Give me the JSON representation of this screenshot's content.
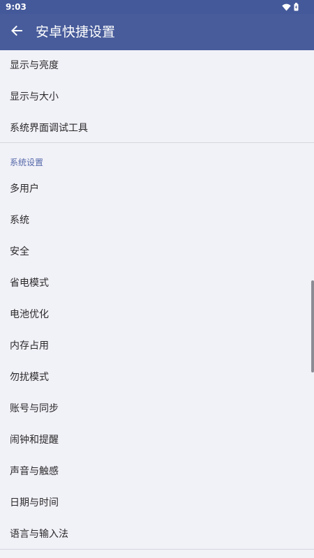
{
  "status_bar": {
    "time": "9:03"
  },
  "app_bar": {
    "title": "安卓快捷设置"
  },
  "group1": {
    "items": [
      {
        "label": "显示与亮度"
      },
      {
        "label": "显示与大小"
      },
      {
        "label": "系统界面调试工具"
      }
    ]
  },
  "group2": {
    "header": "系统设置",
    "items": [
      {
        "label": "多用户"
      },
      {
        "label": "系统"
      },
      {
        "label": "安全"
      },
      {
        "label": "省电模式"
      },
      {
        "label": "电池优化"
      },
      {
        "label": "内存占用"
      },
      {
        "label": "勿扰模式"
      },
      {
        "label": "账号与同步"
      },
      {
        "label": "闹钟和提醒"
      },
      {
        "label": "声音与触感"
      },
      {
        "label": "日期与时间"
      },
      {
        "label": "语言与输入法"
      }
    ]
  },
  "colors": {
    "app_bar": "#485c9b",
    "status_bar": "#44599a",
    "background": "#f1f1f8",
    "section_header": "#5468a8"
  },
  "icons": {
    "back": "arrow-left-icon",
    "wifi": "wifi-icon",
    "battery": "battery-icon"
  }
}
